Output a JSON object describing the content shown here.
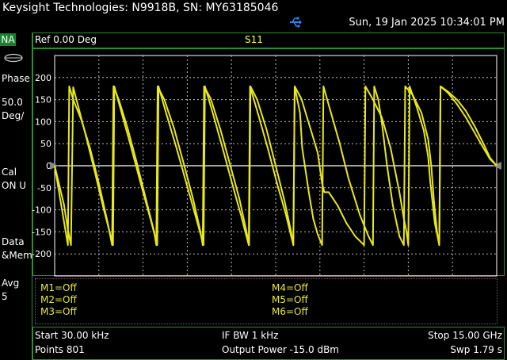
{
  "header": {
    "title": "Keysight Technologies: N9918B, SN: MY63185046",
    "datetime": "Sun, 19 Jan 2025 10:34:01 PM",
    "usb_icon": "usb-icon"
  },
  "left_panel": {
    "mode": "NA",
    "format": "Phase",
    "scale_value": "50.0",
    "scale_unit": "Deg/",
    "cal_label": "Cal",
    "cal_status": "ON U",
    "display_1": "Data",
    "display_2": "&Mem",
    "avg_label": "Avg",
    "avg_value": "5",
    "colors": {
      "badge": "#17832e",
      "border": "#2f8f2f"
    }
  },
  "trace_header": {
    "ref": "Ref 0.00 Deg",
    "measurement": "S11"
  },
  "chart_data": {
    "type": "line",
    "ylim": [
      -250,
      250
    ],
    "yticks": [
      200,
      150,
      100,
      50,
      0,
      -50,
      -100,
      -150,
      -200
    ],
    "ytick_labels": [
      "200",
      "150",
      "100",
      "50",
      "0",
      "-50",
      "-100",
      "-150",
      "-200"
    ],
    "reference_level": 0,
    "grid": true,
    "x_domain": [
      0,
      100
    ],
    "trace_color": "#e8e81a",
    "series": [
      {
        "points": [
          [
            0,
            0
          ],
          [
            2.1,
            -88
          ],
          [
            3,
            -145
          ],
          [
            3.7,
            -180
          ],
          [
            4.2,
            178
          ],
          [
            5.2,
            140
          ],
          [
            7,
            70
          ],
          [
            9,
            -10
          ],
          [
            11,
            -95
          ],
          [
            13.2,
            -180
          ],
          [
            13.5,
            180
          ],
          [
            15.2,
            118
          ],
          [
            17.3,
            42
          ],
          [
            19.4,
            -38
          ],
          [
            21.8,
            -125
          ],
          [
            23.2,
            -180
          ],
          [
            23.5,
            180
          ],
          [
            25.2,
            120
          ],
          [
            27.5,
            42
          ],
          [
            29.8,
            -40
          ],
          [
            31.9,
            -115
          ],
          [
            33.7,
            -180
          ],
          [
            34,
            180
          ],
          [
            35.8,
            118
          ],
          [
            38,
            40
          ],
          [
            40.2,
            -42
          ],
          [
            42.1,
            -110
          ],
          [
            43.9,
            -180
          ],
          [
            44.2,
            180
          ],
          [
            46,
            118
          ],
          [
            48.2,
            40
          ],
          [
            50.3,
            -40
          ],
          [
            52.3,
            -110
          ],
          [
            54,
            -180
          ],
          [
            54.3,
            180
          ],
          [
            55.5,
            120
          ],
          [
            56,
            40
          ],
          [
            57.5,
            -60
          ],
          [
            58.5,
            -120
          ],
          [
            59.5,
            -155
          ],
          [
            60.5,
            -180
          ],
          [
            60.8,
            180
          ],
          [
            62.5,
            120
          ],
          [
            64.5,
            50
          ],
          [
            66.5,
            -30
          ],
          [
            69,
            -110
          ],
          [
            71,
            -160
          ],
          [
            72,
            -180
          ],
          [
            72.3,
            180
          ],
          [
            73.2,
            150
          ],
          [
            74,
            100
          ],
          [
            75.2,
            0
          ],
          [
            76.5,
            -90
          ],
          [
            78,
            -160
          ],
          [
            79,
            -180
          ],
          [
            79.3,
            180
          ],
          [
            81,
            160
          ],
          [
            83,
            120
          ],
          [
            84.5,
            60
          ],
          [
            85.2,
            0
          ],
          [
            85.8,
            -80
          ],
          [
            86.5,
            -150
          ],
          [
            87,
            -180
          ],
          [
            87.3,
            180
          ],
          [
            89,
            168
          ],
          [
            91,
            150
          ],
          [
            93,
            125
          ],
          [
            95,
            90
          ],
          [
            97,
            50
          ],
          [
            98.5,
            18
          ],
          [
            100,
            0
          ]
        ]
      },
      {
        "points": [
          [
            0,
            0
          ],
          [
            3,
            -180
          ],
          [
            3.3,
            180
          ],
          [
            4.2,
            150
          ],
          [
            6,
            105
          ],
          [
            8,
            40
          ],
          [
            10,
            -40
          ],
          [
            12,
            -130
          ],
          [
            13,
            -180
          ],
          [
            13.3,
            180
          ],
          [
            14.5,
            150
          ],
          [
            16.5,
            85
          ],
          [
            18.5,
            10
          ],
          [
            20.5,
            -70
          ],
          [
            22.5,
            -150
          ],
          [
            23,
            -180
          ],
          [
            23.3,
            180
          ],
          [
            24.8,
            150
          ],
          [
            27,
            85
          ],
          [
            29.2,
            5
          ],
          [
            31.3,
            -75
          ],
          [
            33,
            -150
          ],
          [
            33.5,
            -180
          ],
          [
            33.8,
            180
          ],
          [
            35.3,
            152
          ],
          [
            37.5,
            82
          ],
          [
            39.7,
            2
          ],
          [
            41.8,
            -75
          ],
          [
            43.4,
            -150
          ],
          [
            44,
            -180
          ],
          [
            44.3,
            180
          ],
          [
            45.8,
            150
          ],
          [
            48,
            80
          ],
          [
            50,
            0
          ],
          [
            52,
            -80
          ],
          [
            53.5,
            -150
          ],
          [
            54,
            -180
          ],
          [
            54.3,
            180
          ],
          [
            55.8,
            152
          ],
          [
            58,
            80
          ],
          [
            59.5,
            30
          ],
          [
            60.5,
            -40
          ],
          [
            61,
            -60
          ],
          [
            62,
            -60
          ],
          [
            64,
            -90
          ],
          [
            66,
            -130
          ],
          [
            68,
            -160
          ],
          [
            70,
            -180
          ],
          [
            70.3,
            180
          ],
          [
            72,
            150
          ],
          [
            74,
            110
          ],
          [
            76,
            40
          ],
          [
            78,
            -60
          ],
          [
            79,
            -120
          ],
          [
            79.6,
            -150
          ],
          [
            80,
            -180
          ],
          [
            80.3,
            180
          ],
          [
            82,
            130
          ],
          [
            83.5,
            80
          ],
          [
            84.5,
            20
          ],
          [
            85,
            -40
          ],
          [
            86,
            -130
          ],
          [
            87,
            -180
          ],
          [
            87.3,
            180
          ],
          [
            89,
            165
          ],
          [
            91,
            140
          ],
          [
            93,
            110
          ],
          [
            95,
            75
          ],
          [
            97,
            40
          ],
          [
            98.5,
            15
          ],
          [
            100,
            0
          ]
        ]
      }
    ]
  },
  "markers": {
    "col1": [
      "M1=Off",
      "M2=Off",
      "M3=Off"
    ],
    "col2": [
      "M4=Off",
      "M5=Off",
      "M6=Off"
    ]
  },
  "status": {
    "start": "Start 30.00 kHz",
    "points": "Points 801",
    "ifbw": "IF BW 1 kHz",
    "power": "Output Power -15.0 dBm",
    "stop": "Stop 15.00 GHz",
    "sweep": "Swp 1.79 s"
  }
}
